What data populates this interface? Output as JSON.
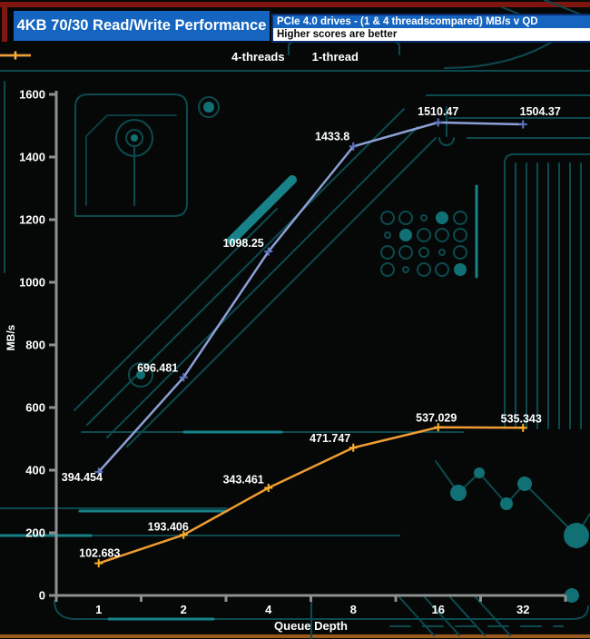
{
  "header": {
    "title": "4KB 70/30 Read/Write Performance",
    "subtitle": "PCIe 4.0 drives - (1 & 4 threadscompared) MB/s v QD",
    "note": "Higher scores are better"
  },
  "colors": {
    "title_bar_blue": "#1565c0",
    "axis_gray": "#8f8f8f",
    "text_white": "#ffffff",
    "background_black": "#060808",
    "pcb_trace_dark": "#0d4a4e",
    "pcb_trace_bright": "#178288",
    "pcb_fill": "#117074",
    "pcb_trace_red": "#7e150f",
    "pcb_trace_bottom_orange": "#995a1e"
  },
  "chart_data": {
    "type": "line",
    "title": "4KB 70/30 Read/Write Performance",
    "subtitle": "PCIe 4.0 drives - (1 & 4 threadscompared) MB/s v QD",
    "note": "Higher scores are better",
    "xlabel": "Queue Depth",
    "ylabel": "MB/s",
    "x_scale": "category",
    "categories": [
      "1",
      "2",
      "4",
      "8",
      "16",
      "32"
    ],
    "ylim": [
      0,
      1600
    ],
    "yticks": [
      0,
      200,
      400,
      600,
      800,
      1000,
      1200,
      1400,
      1600
    ],
    "grid": false,
    "legend_position": "top-center",
    "value_labels_shown": true,
    "series": [
      {
        "name": "4-threads",
        "color": "#8da0d6",
        "marker_color": "#5c74c0",
        "values": [
          394.454,
          696.481,
          1098.25,
          1433.8,
          1510.47,
          1504.37
        ],
        "value_labels": [
          "394.454",
          "696.481",
          "1098.25",
          "1433.8",
          "1510.47",
          "1504.37"
        ]
      },
      {
        "name": "1-thread",
        "color": "#ef9c33",
        "marker_color": "#ffb02e",
        "values": [
          102.683,
          193.406,
          343.461,
          471.747,
          537.029,
          535.343
        ],
        "value_labels": [
          "102.683",
          "193.406",
          "343.461",
          "471.747",
          "537.029",
          "535.343"
        ]
      }
    ]
  }
}
